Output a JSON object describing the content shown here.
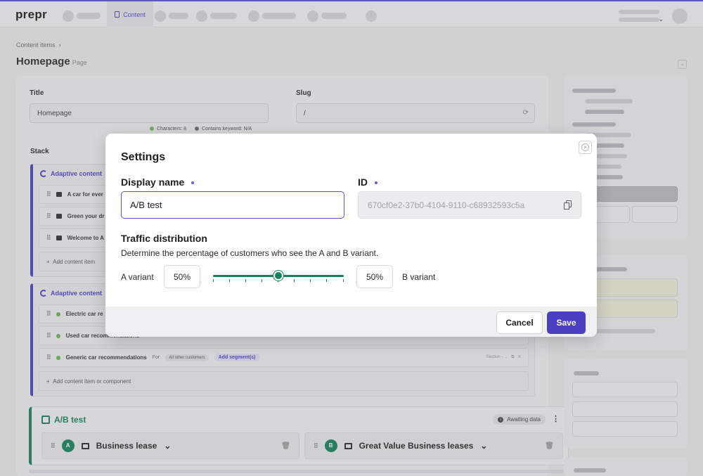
{
  "app": {
    "logo": "prepr"
  },
  "topnav": {
    "active_tab": "Content"
  },
  "breadcrumb": {
    "item": "Content items"
  },
  "page": {
    "title": "Homepage",
    "type": "Page"
  },
  "form": {
    "title_label": "Title",
    "title_value": "Homepage",
    "slug_label": "Slug",
    "slug_value": "/",
    "characters": "Characters: 8",
    "keyword": "Contains keyword: N/A",
    "stack_label": "Stack"
  },
  "stack": {
    "block1": {
      "header": "Adaptive content",
      "items": [
        "A car for ever",
        "Green your dr",
        "Welcome to A"
      ],
      "add_label": "Add content item"
    },
    "block2": {
      "header": "Adaptive content",
      "items": [
        "Electric car re",
        "Used car recommendations",
        "Generic car recommendations"
      ],
      "for_label": "For",
      "other_customers": "All other customers",
      "add_segment": "Add segment(s)",
      "section_tag": "Section - ...",
      "add_label": "Add content item or component"
    },
    "ab_test": {
      "title": "A/B test",
      "status": "Awaiting data",
      "variant_a": {
        "badge": "A",
        "name": "Business lease"
      },
      "variant_b": {
        "badge": "B",
        "name": "Great Value Business leases"
      }
    }
  },
  "modal": {
    "title": "Settings",
    "display_name_label": "Display name",
    "display_name_value": "A/B test",
    "id_label": "ID",
    "id_value": "670cf0e2-37b0-4104-9110-c68932593c5a",
    "traffic_title": "Traffic distribution",
    "traffic_desc": "Determine the percentage of customers who see the A and B variant.",
    "a_label": "A variant",
    "a_pct": "50%",
    "b_label": "B variant",
    "b_pct": "50%",
    "slider_value_pct": 50,
    "cancel_label": "Cancel",
    "save_label": "Save"
  },
  "colors": {
    "accent": "#4b3fc4",
    "ab_green": "#12805a"
  },
  "icons": [
    "close-icon",
    "copy-icon",
    "refresh-icon",
    "image-icon",
    "trash-icon",
    "info-icon",
    "kebab-icon",
    "chevron-down-icon",
    "grip-icon"
  ]
}
